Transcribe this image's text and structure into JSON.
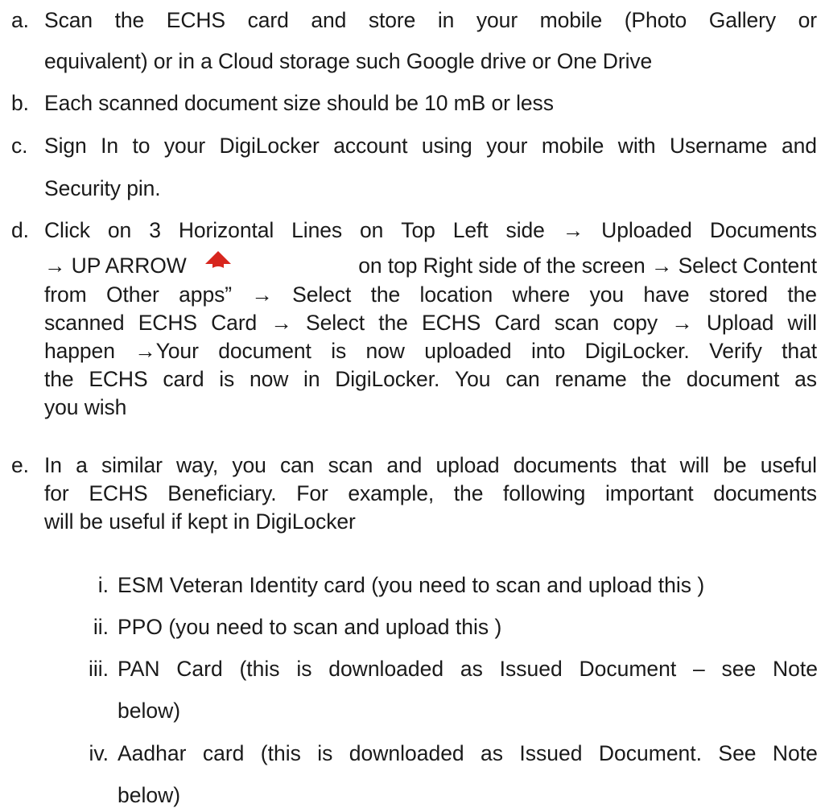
{
  "items": [
    {
      "marker": "a.",
      "line1_words": [
        "Scan",
        "the",
        "ECHS",
        "card",
        "and",
        "store",
        "in",
        "your",
        "mobile",
        "(Photo",
        "Gallery",
        "or"
      ],
      "line2": "equivalent) or in a Cloud storage such Google drive or One Drive"
    },
    {
      "marker": "b.",
      "line1": "Each scanned document size should be 10 mB or less"
    },
    {
      "marker": "c.",
      "line1_words": [
        "Sign",
        "In",
        "to",
        "your",
        "DigiLocker",
        "account",
        "using",
        "your",
        "mobile",
        "with",
        "Username",
        "and"
      ],
      "line2": "Security pin."
    },
    {
      "marker": "d.",
      "line1_words": [
        "Click",
        "on",
        "3",
        "Horizontal",
        "Lines",
        "on",
        "Top",
        "Left",
        "side",
        "→",
        "Uploaded",
        "Documents"
      ],
      "line2a": "→ UP ARROW",
      "line2b": "on top Right side of the screen → Select Content",
      "line3_words": [
        "from",
        "Other",
        "apps”",
        "→",
        "Select",
        "the",
        "location",
        "where",
        "you",
        "have",
        "stored",
        "the"
      ],
      "line4_words": [
        "scanned",
        "ECHS",
        "Card",
        "→",
        "Select",
        "the",
        "ECHS",
        "Card",
        "scan",
        "copy",
        "→",
        "Upload",
        "will"
      ],
      "line5_words": [
        "happen",
        "→Your",
        "document",
        "is",
        "now",
        "uploaded",
        "into",
        "DigiLocker.",
        "Verify",
        "that"
      ],
      "line6_words": [
        "the",
        "ECHS",
        "card",
        "is",
        "now",
        "in",
        "DigiLocker.",
        "You",
        "can",
        "rename",
        "the",
        "document",
        "as"
      ],
      "line7": "you wish"
    },
    {
      "marker": "e.",
      "line1_words": [
        "In",
        "a",
        "similar",
        "way,",
        "you",
        "can",
        "scan",
        "and",
        "upload",
        "documents",
        "that",
        "will",
        "be",
        "useful"
      ],
      "line2_words": [
        "for",
        "ECHS",
        "Beneficiary.",
        "For",
        "example,",
        "the",
        "following",
        "important",
        "documents"
      ],
      "line3": "will be useful if kept in DigiLocker"
    }
  ],
  "subitems": [
    {
      "marker": "i.",
      "line1": "ESM Veteran Identity card (you need to scan and upload this )"
    },
    {
      "marker": "ii.",
      "line1": "PPO (you need to scan and upload this )"
    },
    {
      "marker": "iii.",
      "line1_words": [
        "PAN",
        "Card",
        "(this",
        "is",
        "downloaded",
        "as",
        "Issued",
        "Document",
        "–",
        "see",
        "Note"
      ],
      "line2": "below)"
    },
    {
      "marker": "iv.",
      "line1_words": [
        "Aadhar",
        "card",
        "(this",
        "is",
        "downloaded",
        "as",
        "Issued",
        "Document.",
        "See",
        "Note"
      ],
      "line2": "below)"
    }
  ],
  "icons": {
    "up_arrow": "up-arrow-icon",
    "up_arrow_color": "#d7261e"
  }
}
